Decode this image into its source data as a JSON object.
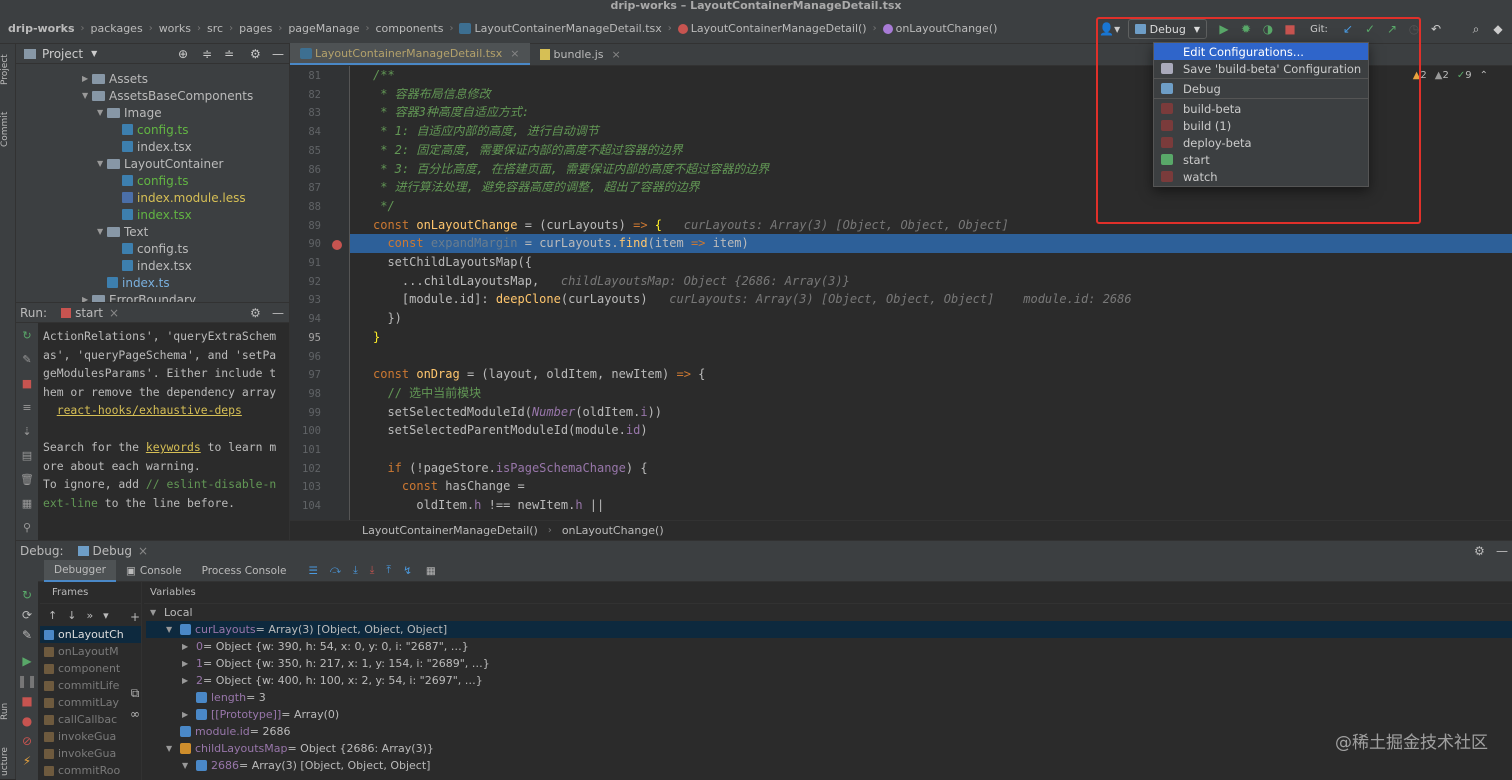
{
  "window": {
    "title": "drip-works – LayoutContainerManageDetail.tsx"
  },
  "breadcrumb": [
    "drip-works",
    "packages",
    "works",
    "src",
    "pages",
    "pageManage",
    "components",
    "LayoutContainerManageDetail.tsx",
    "LayoutContainerManageDetail()",
    "onLayoutChange()"
  ],
  "toolbar": {
    "config": "Debug",
    "git": "Git:"
  },
  "dropdown": {
    "items": [
      {
        "label": "Edit Configurations...",
        "icon": "none",
        "selected": true
      },
      {
        "label": "Save 'build-beta' Configuration",
        "icon": "save-icon"
      },
      {
        "label": "Debug",
        "icon": "debug-config-icon"
      },
      {
        "label": "build-beta",
        "icon": "npm-icon"
      },
      {
        "label": "build (1)",
        "icon": "npm-icon"
      },
      {
        "label": "deploy-beta",
        "icon": "npm-icon"
      },
      {
        "label": "start",
        "icon": "npm-running-icon"
      },
      {
        "label": "watch",
        "icon": "npm-icon"
      }
    ]
  },
  "sidebar": {
    "project_tab": "Project",
    "commit_tab": "Commit",
    "run_tab": "Run",
    "structure_tab": "ucture"
  },
  "project": {
    "header": "Project",
    "tree": [
      {
        "label": "Assets",
        "type": "folder",
        "indent": 1,
        "arrow": "▶"
      },
      {
        "label": "AssetsBaseComponents",
        "type": "folder",
        "indent": 1,
        "arrow": "▼"
      },
      {
        "label": "Image",
        "type": "folder",
        "indent": 2,
        "arrow": "▼"
      },
      {
        "label": "config.ts",
        "type": "ts-green",
        "indent": 3,
        "arrow": ""
      },
      {
        "label": "index.tsx",
        "type": "tsx",
        "indent": 3,
        "arrow": ""
      },
      {
        "label": "LayoutContainer",
        "type": "folder",
        "indent": 2,
        "arrow": "▼"
      },
      {
        "label": "config.ts",
        "type": "ts-green",
        "indent": 3,
        "arrow": ""
      },
      {
        "label": "index.module.less",
        "type": "less",
        "indent": 3,
        "arrow": ""
      },
      {
        "label": "index.tsx",
        "type": "tsx-green",
        "indent": 3,
        "arrow": ""
      },
      {
        "label": "Text",
        "type": "folder",
        "indent": 2,
        "arrow": "▼"
      },
      {
        "label": "config.ts",
        "type": "ts",
        "indent": 3,
        "arrow": ""
      },
      {
        "label": "index.tsx",
        "type": "tsx",
        "indent": 3,
        "arrow": ""
      },
      {
        "label": "index.ts",
        "type": "ts-blue",
        "indent": 2,
        "arrow": ""
      },
      {
        "label": "ErrorBoundary",
        "type": "folder",
        "indent": 1,
        "arrow": "▶"
      }
    ]
  },
  "run": {
    "label": "Run:",
    "tab": "start",
    "lines": [
      "ActionRelations', 'queryExtraSchem",
      "as', 'queryPageSchema', and 'setPa",
      "geModulesParams'. Either include t",
      "hem or remove the dependency array",
      "  react-hooks/exhaustive-deps",
      "",
      "Search for the keywords to learn m",
      "ore about each warning.",
      "To ignore, add // eslint-disable-n",
      "ext-line to the line before."
    ],
    "link": "react-hooks/exhaustive-deps",
    "keywords": "keywords"
  },
  "editor": {
    "tabs": [
      {
        "label": "LayoutContainerManageDetail.tsx",
        "active": true
      },
      {
        "label": "bundle.js",
        "active": false
      }
    ],
    "warnings": {
      "w": "2",
      "weak": "2",
      "ok": "9"
    },
    "line_numbers": [
      "81",
      "82",
      "83",
      "84",
      "85",
      "86",
      "87",
      "88",
      "89",
      "90",
      "91",
      "92",
      "93",
      "94",
      "95",
      "96",
      "97",
      "98",
      "99",
      "100",
      "101",
      "102",
      "103",
      "104"
    ],
    "status": [
      "LayoutContainerManageDetail()",
      "onLayoutChange()"
    ]
  },
  "debug": {
    "label": "Debug:",
    "tab": "Debug",
    "subtabs": [
      "Debugger",
      "Console",
      "Process Console"
    ],
    "frames_header": "Frames",
    "variables_header": "Variables",
    "frames": [
      "onLayoutCh",
      "onLayoutM",
      "component",
      "commitLife",
      "commitLay",
      "callCallbac",
      "invokeGua",
      "invokeGua",
      "commitRoo"
    ],
    "variables": [
      {
        "indent": 0,
        "arrow": "▼",
        "icon": "",
        "name": "Local",
        "rest": ""
      },
      {
        "indent": 1,
        "arrow": "▼",
        "icon": "list",
        "name": "curLayouts",
        "rest": " = Array(3) [Object, Object, Object]",
        "selected": true
      },
      {
        "indent": 2,
        "arrow": "▶",
        "icon": "",
        "name": "0",
        "rest": " = Object {w: 390, h: 54, x: 0, y: 0, i: \"2687\", …}"
      },
      {
        "indent": 2,
        "arrow": "▶",
        "icon": "",
        "name": "1",
        "rest": " = Object {w: 350, h: 217, x: 1, y: 154, i: \"2689\", …}"
      },
      {
        "indent": 2,
        "arrow": "▶",
        "icon": "",
        "name": "2",
        "rest": " = Object {w: 400, h: 100, x: 2, y: 54, i: \"2697\", …}"
      },
      {
        "indent": 2,
        "arrow": "",
        "icon": "field",
        "name": "length",
        "rest": " = 3"
      },
      {
        "indent": 2,
        "arrow": "▶",
        "icon": "list",
        "name": "[[Prototype]]",
        "rest": " = Array(0)"
      },
      {
        "indent": 1,
        "arrow": "",
        "icon": "field",
        "name": "module.id",
        "rest": " = 2686"
      },
      {
        "indent": 1,
        "arrow": "▼",
        "icon": "obj",
        "name": "childLayoutsMap",
        "rest": " = Object {2686: Array(3)}"
      },
      {
        "indent": 2,
        "arrow": "▼",
        "icon": "list",
        "name": "2686",
        "rest": " = Array(3) [Object, Object, Object]"
      }
    ]
  },
  "watermark": "@稀土掘金技术社区",
  "colors": {
    "accent": "#2f65ca",
    "highlight": "#2d6099",
    "annotation": "#e0302a"
  }
}
